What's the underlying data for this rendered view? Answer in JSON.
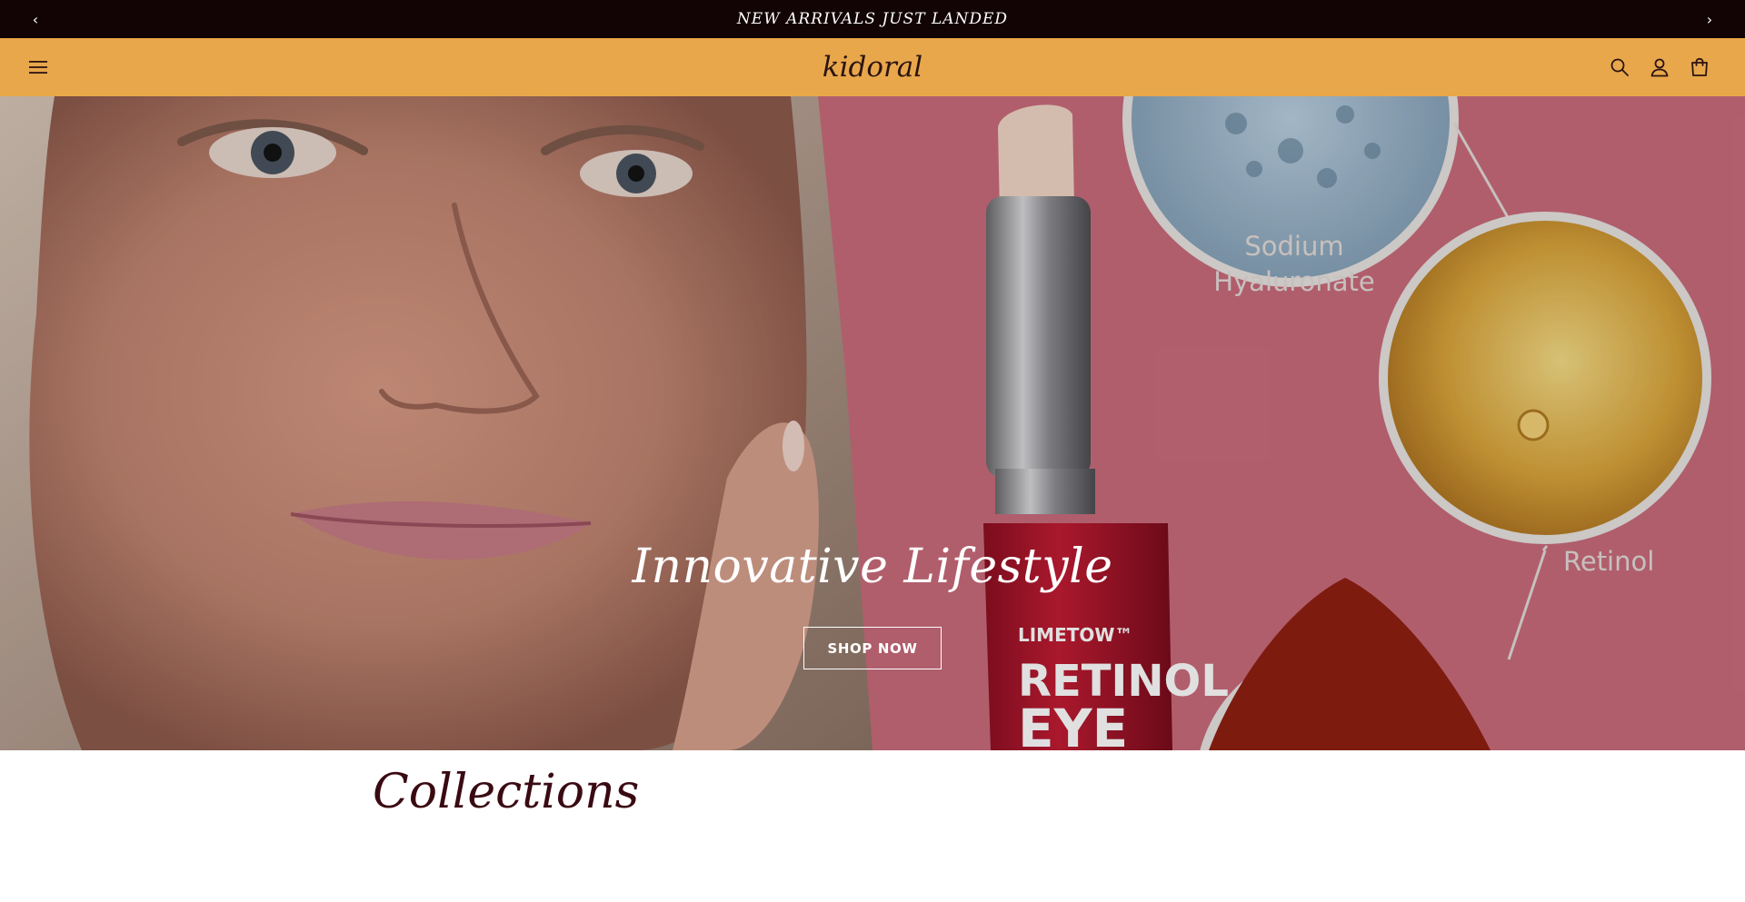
{
  "announcement": {
    "text": "NEW ARRIVALS JUST LANDED",
    "prev_icon": "chevron-left-icon",
    "next_icon": "chevron-right-icon"
  },
  "header": {
    "logo": "kidoral",
    "icons": [
      "hamburger-menu-icon",
      "search-icon",
      "account-icon",
      "cart-icon"
    ],
    "background_color": "#e8a74b"
  },
  "hero": {
    "heading": "Innovative Lifestyle",
    "button_label": "SHOP NOW",
    "image_labels": {
      "ingredient_1": [
        "Sodium",
        "Hyaluronate"
      ],
      "ingredient_2": "Retinol",
      "product_brand": "LIMETOW™",
      "product_name_line1": "RETINOL",
      "product_name_line2": "EYE"
    }
  },
  "collections": {
    "title": "Collections"
  },
  "colors": {
    "announcement_bg": "#120305",
    "header_bg": "#e8a74b",
    "hero_pink": "#c96b7c",
    "collections_text": "#3a0a12"
  }
}
